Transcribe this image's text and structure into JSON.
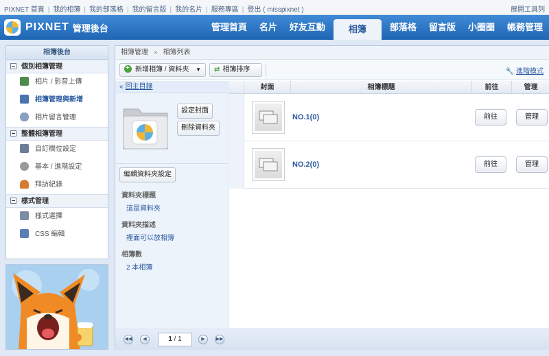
{
  "topbar": {
    "links": [
      "PIXNET 首頁",
      "我的相簿",
      "我的部落格",
      "我的留言版",
      "我的名片",
      "服務專區",
      "登出 ( misspixnet )"
    ],
    "tools": "展開工具列"
  },
  "header": {
    "logo_text": "PIXNET",
    "logo_sub": "管理後台",
    "nav": [
      "管理首頁",
      "名片",
      "好友互動",
      "相簿",
      "部落格",
      "留言版",
      "小圈圈",
      "帳務管理"
    ],
    "active_nav": "相簿"
  },
  "sidebar": {
    "title": "相簿後台",
    "sections": [
      {
        "label": "個別相簿管理",
        "items": [
          {
            "label": "相片 / 影音上傳",
            "icon": "photo-upload-icon",
            "color": "#4f8a4a"
          },
          {
            "label": "相簿管理與新增",
            "icon": "album-manage-icon",
            "color": "#4a73b0",
            "active": true
          },
          {
            "label": "相片留言管理",
            "icon": "comment-icon",
            "color": "#8aa0c2"
          }
        ]
      },
      {
        "label": "整體相簿管理",
        "items": [
          {
            "label": "自訂欄位設定",
            "icon": "custom-field-icon",
            "color": "#6d7d95"
          },
          {
            "label": "基本 / 進階設定",
            "icon": "gear-icon",
            "color": "#9a9a9a"
          },
          {
            "label": "拜訪紀錄",
            "icon": "visitor-icon",
            "color": "#d77b2f"
          }
        ]
      },
      {
        "label": "樣式管理",
        "items": [
          {
            "label": "樣式選擇",
            "icon": "style-icon",
            "color": "#7b8ca4"
          },
          {
            "label": "CSS 編輯",
            "icon": "css-icon",
            "color": "#5a7fb5"
          }
        ]
      }
    ]
  },
  "breadcrumb": {
    "root": "相簿管理",
    "sep": "»",
    "current": "相簿列表"
  },
  "toolbar": {
    "add_label": "新增相簿 / 資料夾",
    "sort_label": "相簿排序",
    "advanced_label": "進階模式"
  },
  "folder_panel": {
    "back_arrow": "«",
    "back_label": "回主目錄",
    "set_cover_label": "設定封面",
    "delete_folder_label": "刪除資料夾",
    "edit_settings_label": "編輯資料夾設定",
    "title_label": "資料夾標題",
    "title_value": "這是資料夾",
    "desc_label": "資料夾描述",
    "desc_value": "裡面可以放相簿",
    "count_label": "相簿數",
    "count_value": "2 本相簿"
  },
  "table": {
    "headers": {
      "cover": "封面",
      "title": "相簿標題",
      "go": "前往",
      "manage": "管理"
    },
    "rows": [
      {
        "title": "NO.1(0)",
        "go_label": "前往",
        "manage_label": "管理"
      },
      {
        "title": "NO.2(0)",
        "go_label": "前往",
        "manage_label": "管理"
      }
    ]
  },
  "pager": {
    "page": "1",
    "total": "1"
  }
}
